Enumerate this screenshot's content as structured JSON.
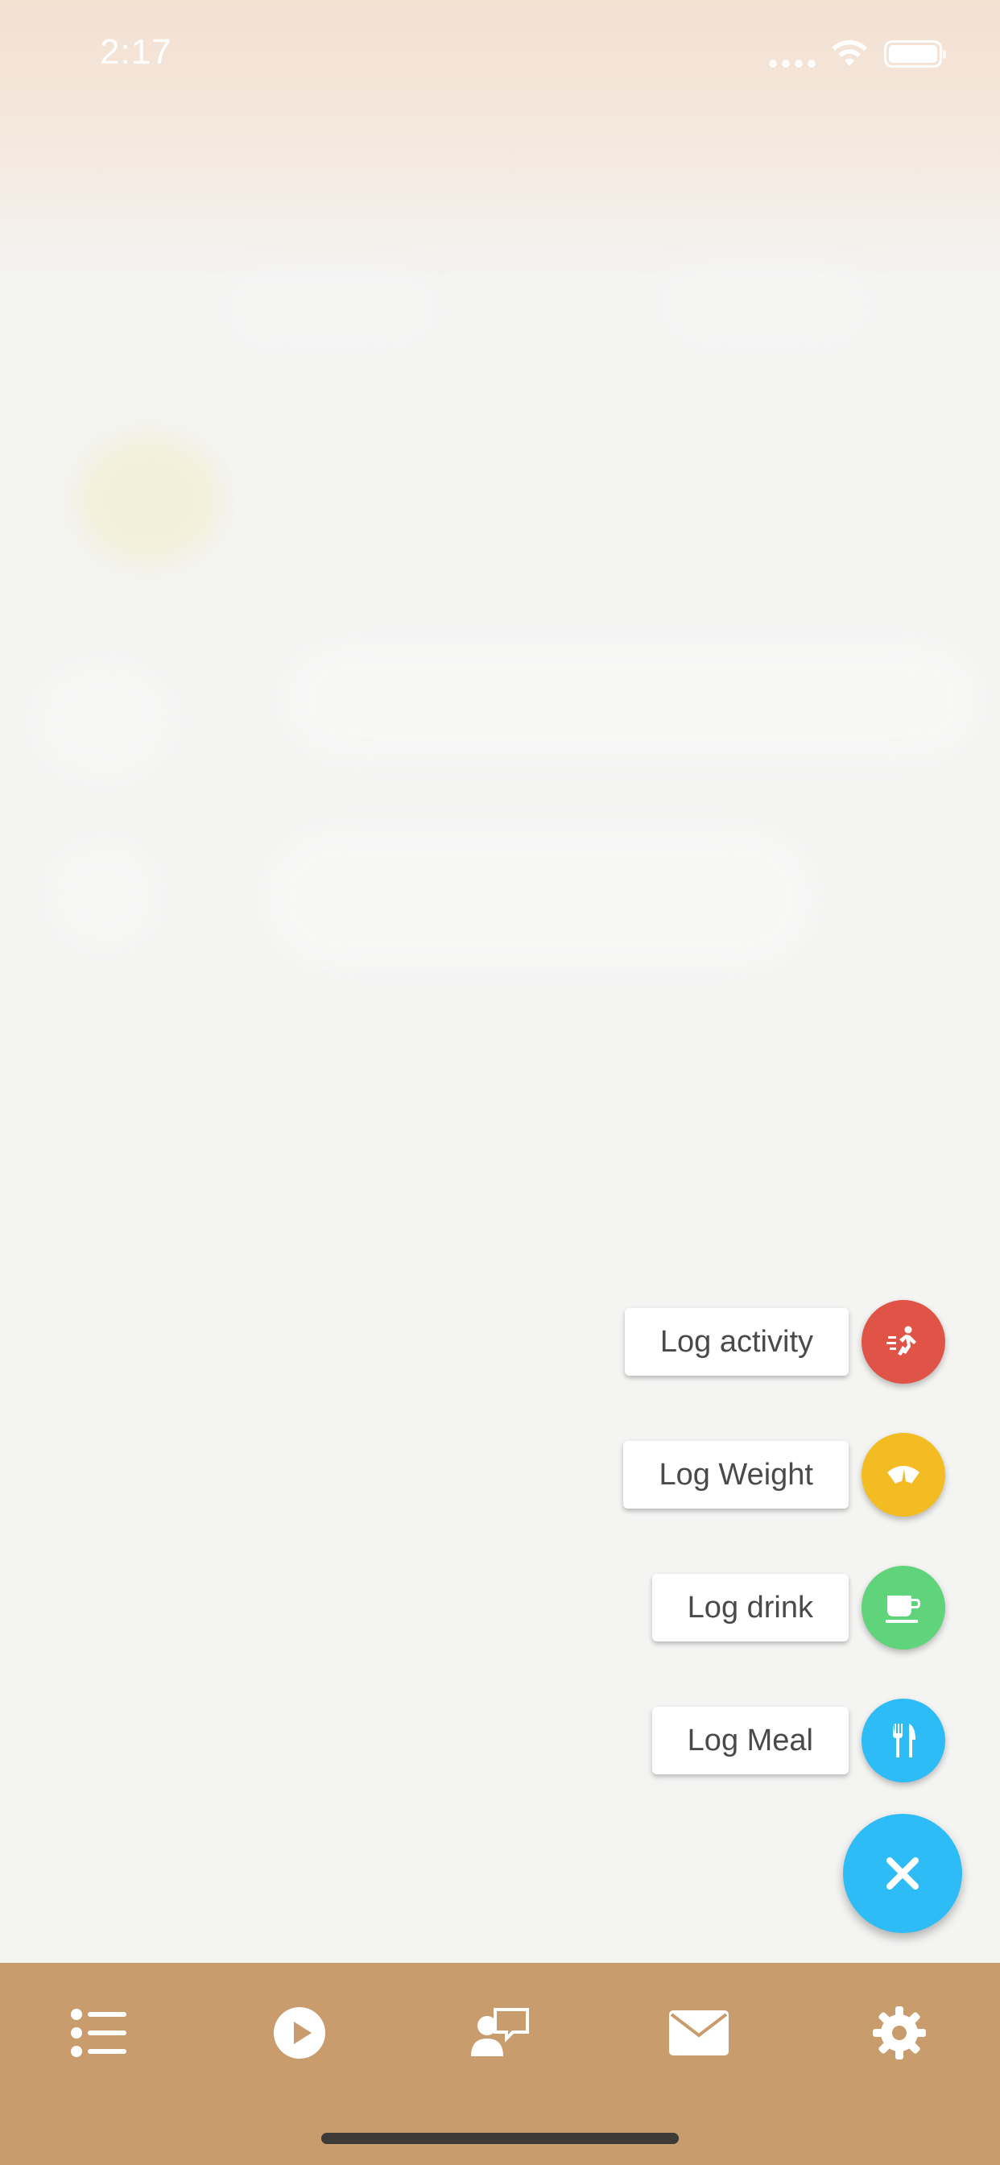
{
  "status_bar": {
    "time": "2:17"
  },
  "quick_actions": [
    {
      "label": "Log activity",
      "icon": "running-icon",
      "color": "#e05447"
    },
    {
      "label": "Log Weight",
      "icon": "scale-icon",
      "color": "#f3bc22"
    },
    {
      "label": "Log drink",
      "icon": "cup-icon",
      "color": "#5fd47a"
    },
    {
      "label": "Log Meal",
      "icon": "utensils-icon",
      "color": "#2ebcf6"
    }
  ],
  "main_fab": {
    "icon": "close-icon",
    "color": "#2ebcf6"
  },
  "tab_bar": {
    "color": "#c89c6c",
    "items": [
      {
        "icon": "list-icon"
      },
      {
        "icon": "play-icon"
      },
      {
        "icon": "coach-chat-icon"
      },
      {
        "icon": "mail-icon"
      },
      {
        "icon": "gear-icon"
      }
    ]
  }
}
